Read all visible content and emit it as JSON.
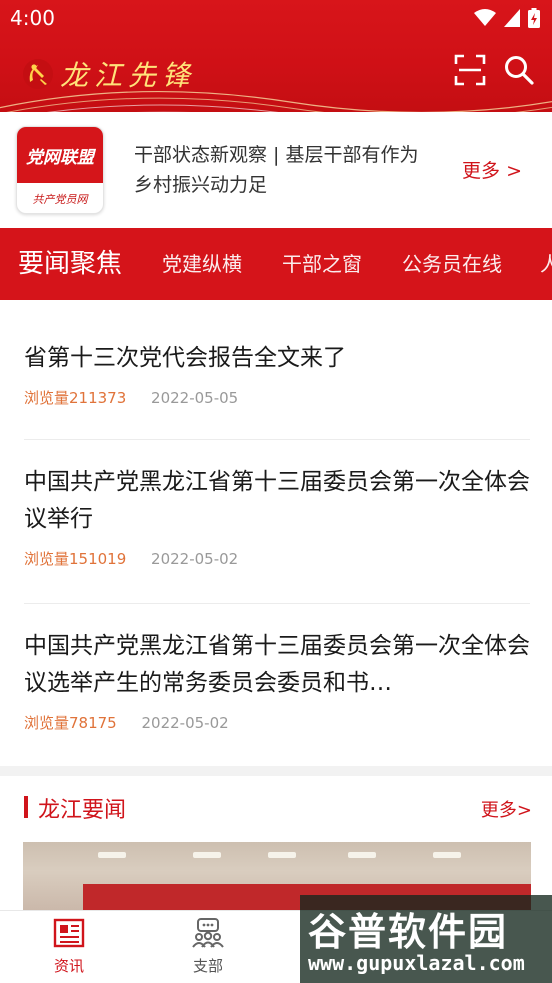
{
  "status_bar": {
    "time": "4:00"
  },
  "header": {
    "title": "龙江先锋",
    "scan_icon": "scan-icon",
    "search_icon": "search-icon",
    "brand_color": "#d5141a",
    "accent_gold": "#ffe37a"
  },
  "banner": {
    "logo_top": "党网联盟",
    "logo_bottom": "共产党员网",
    "text": "干部状态新观察 | 基层干部有作为 乡村振兴动力足",
    "more": "更多 >"
  },
  "tabs": [
    {
      "label": "要闻聚焦",
      "active": true
    },
    {
      "label": "党建纵横",
      "active": false
    },
    {
      "label": "干部之窗",
      "active": false
    },
    {
      "label": "公务员在线",
      "active": false
    },
    {
      "label": "人",
      "active": false
    }
  ],
  "news": [
    {
      "title": "省第十三次党代会报告全文来了",
      "views": "浏览量211373",
      "date": "2022-05-05"
    },
    {
      "title": "中国共产党黑龙江省第十三届委员会第一次全体会议举行",
      "views": "浏览量151019",
      "date": "2022-05-02"
    },
    {
      "title": "中国共产党黑龙江省第十三届委员会第一次全体会议选举产生的常务委员会委员和书…",
      "views": "浏览量78175",
      "date": "2022-05-02"
    }
  ],
  "section": {
    "title": "龙江要闻",
    "more": "更多>"
  },
  "bottom_nav": [
    {
      "label": "资讯",
      "icon": "newspaper-icon",
      "active": true
    },
    {
      "label": "支部",
      "icon": "group-chat-icon",
      "active": false
    }
  ],
  "watermark": {
    "big": "谷普软件园",
    "small": "www.gupuxlazal.com"
  }
}
